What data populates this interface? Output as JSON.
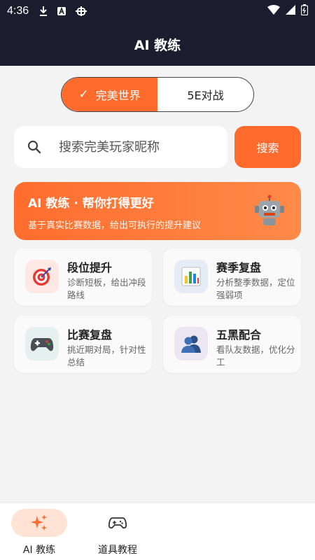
{
  "status_bar": {
    "time": "4:36",
    "icons": [
      "download-icon",
      "a-box-icon",
      "bug-icon",
      "wifi-icon",
      "signal-icon",
      "battery-icon"
    ]
  },
  "app_bar": {
    "title": "AI 教练"
  },
  "segment": {
    "options": [
      {
        "label": "完美世界",
        "selected": true
      },
      {
        "label": "5E对战",
        "selected": false
      }
    ]
  },
  "search": {
    "placeholder": "搜索完美玩家昵称",
    "button_label": "搜索"
  },
  "banner": {
    "title": "AI 教练 · 帮你打得更好",
    "subtitle": "基于真实比赛数据，给出可执行的提升建议",
    "icon": "robot-icon"
  },
  "cards": [
    {
      "title": "段位提升",
      "desc": "诊断短板，给出冲段路线",
      "icon": "target-icon"
    },
    {
      "title": "赛季复盘",
      "desc": "分析整季数据，定位强弱项",
      "icon": "bar-chart-icon"
    },
    {
      "title": "比赛复盘",
      "desc": "挑近期对局，针对性总结",
      "icon": "gamepad-icon"
    },
    {
      "title": "五黑配合",
      "desc": "看队友数据，优化分工",
      "icon": "team-icon"
    }
  ],
  "bottom_nav": {
    "items": [
      {
        "label": "AI 教练",
        "icon": "sparkle-icon",
        "active": true
      },
      {
        "label": "道具教程",
        "icon": "controller-icon",
        "active": false
      }
    ]
  },
  "colors": {
    "accent": "#ff6b2c",
    "header_bg": "#1b1d2e",
    "page_bg": "#f3f3f3"
  }
}
